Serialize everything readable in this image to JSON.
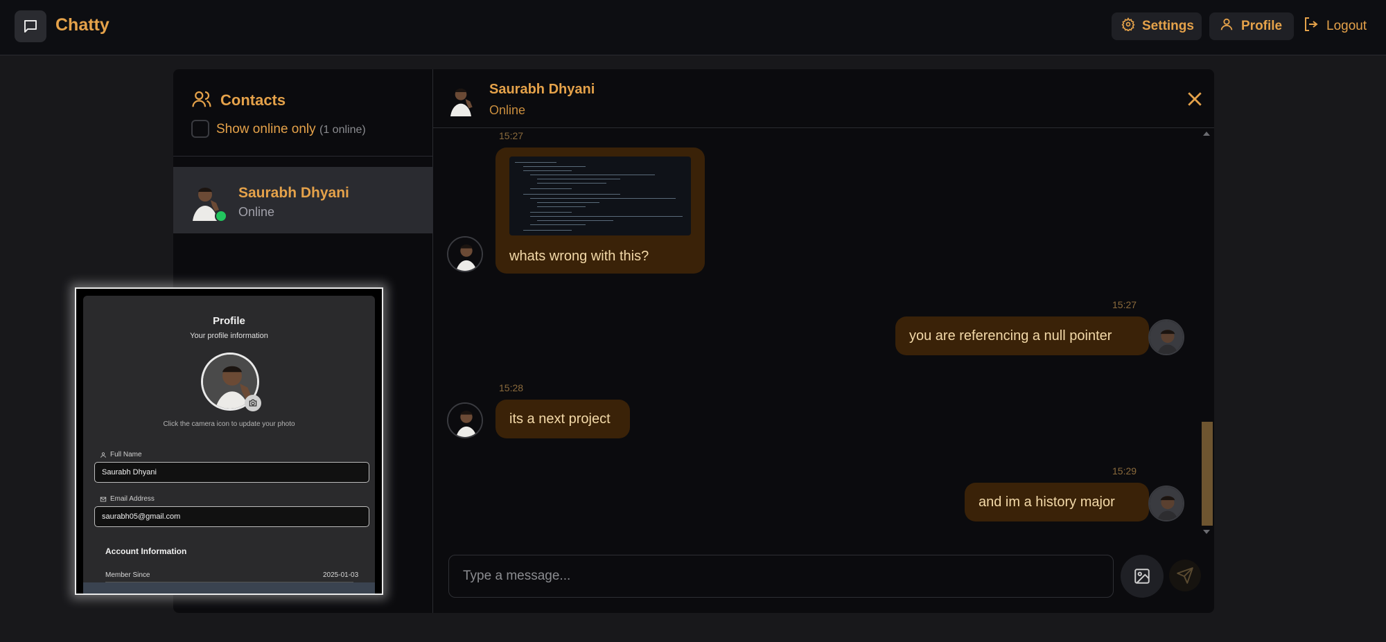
{
  "app": {
    "brand": "Chatty"
  },
  "nav": {
    "settings_label": "Settings",
    "profile_label": "Profile",
    "logout_label": "Logout"
  },
  "sidebar": {
    "title": "Contacts",
    "filter_label": "Show online only",
    "online_count": "(1 online)",
    "contacts": [
      {
        "name": "Saurabh Dhyani",
        "status": "Online"
      }
    ]
  },
  "chat_header": {
    "name": "Saurabh Dhyani",
    "status": "Online"
  },
  "messages": [
    {
      "time": "15:27",
      "text": "whats wrong with this?",
      "side": "left",
      "has_image": true
    },
    {
      "time": "15:27",
      "text": "you are referencing a null pointer",
      "side": "right"
    },
    {
      "time": "15:28",
      "text": "its a next project",
      "side": "left"
    },
    {
      "time": "15:29",
      "text": "and im a history major",
      "side": "right"
    }
  ],
  "composer": {
    "placeholder": "Type a message..."
  },
  "profile_preview": {
    "title": "Profile",
    "subtitle": "Your profile information",
    "hint": "Click the camera icon to update your photo",
    "full_name_label": "Full Name",
    "full_name": "Saurabh Dhyani",
    "email_label": "Email Address",
    "email": "saurabh05@gmail.com",
    "account_title": "Account Information",
    "member_since_label": "Member Since",
    "member_since": "2025-01-03"
  },
  "colors": {
    "accent": "#e5a24a",
    "bubble": "#3a2208",
    "online": "#22c55e",
    "background": "#18181b"
  }
}
